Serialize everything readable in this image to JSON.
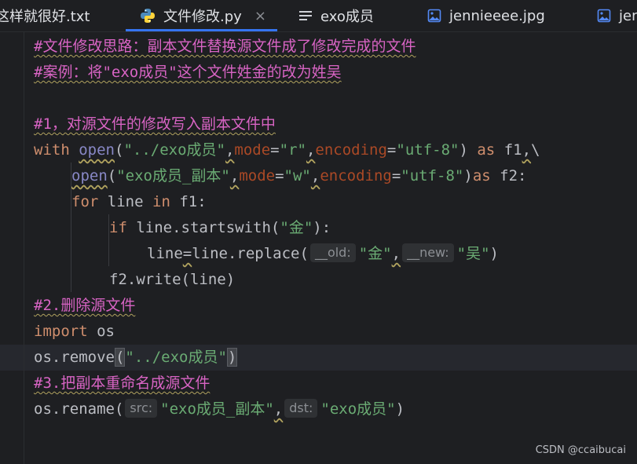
{
  "tabs": [
    {
      "label": "这样就很好.txt",
      "icon": "text-file-icon"
    },
    {
      "label": "文件修改.py",
      "icon": "python-icon",
      "close": "×"
    },
    {
      "label": "exo成员",
      "icon": "text-lines-icon"
    },
    {
      "label": "jennieeee.jpg",
      "icon": "image-icon"
    },
    {
      "label": "jen",
      "icon": "image-icon"
    }
  ],
  "code": {
    "l1": "#文件修改思路：副本文件替换源文件成了修改完成的文件",
    "l2": "#案例：将\"exo成员\"这个文件姓金的改为姓吴",
    "l4": "#1，对源文件的修改写入副本文件中",
    "l5": {
      "kw_with": "with",
      "open": "open",
      "p1": "(",
      "s1": "\"../exo成员\"",
      "c1": ",",
      "mode": "mode",
      "eq": "=",
      "s2": "\"r\"",
      "c2": ",",
      "enc": "encoding",
      "s3": "\"utf-8\"",
      "p2": ")",
      "kw_as": "as",
      "var": "f1",
      "c3": ",",
      "bs": "\\"
    },
    "l6": {
      "open": "open",
      "p1": "(",
      "s1": "\"exo成员_副本\"",
      "c1": ",",
      "mode": "mode",
      "eq": "=",
      "s2": "\"w\"",
      "c2": ",",
      "enc": "encoding",
      "s3": "\"utf-8\"",
      "p2": ")",
      "kw_as": "as",
      "var": "f2:"
    },
    "l7": {
      "kw_for": "for",
      "var": "line",
      "kw_in": "in",
      "rest": "f1:"
    },
    "l8": {
      "kw_if": "if",
      "expr": "line.startswith(",
      "s1": "\"金\"",
      "end": "):"
    },
    "l9": {
      "lhs": "line",
      "eq": "=",
      "expr": "line.replace(",
      "h1": "__old:",
      "s1": "\"金\"",
      "c1": ",",
      "h2": "__new:",
      "s2": "\"吴\"",
      "end": ")"
    },
    "l10": "f2.write(line)",
    "l11": "#2.删除源文件",
    "l12": {
      "kw_import": "import",
      "mod": "os"
    },
    "l13": {
      "expr": "os.remove",
      "p1": "(",
      "s1": "\"../exo成员\"",
      "p2": ")"
    },
    "l14": "#3.把副本重命名成源文件",
    "l15": {
      "expr": "os.rename(",
      "h1": "src:",
      "s1": "\"exo成员_副本\"",
      "c1": ",",
      "h2": "dst:",
      "s2": "\"exo成员\"",
      "end": ")"
    }
  },
  "watermark": "CSDN @ccaibucai",
  "colors": {
    "background": "#1e1f22",
    "accent": "#3574f0",
    "keyword": "#cf8e6d",
    "string": "#6aab73",
    "comment": "#d864c4",
    "param": "#aa4926"
  }
}
